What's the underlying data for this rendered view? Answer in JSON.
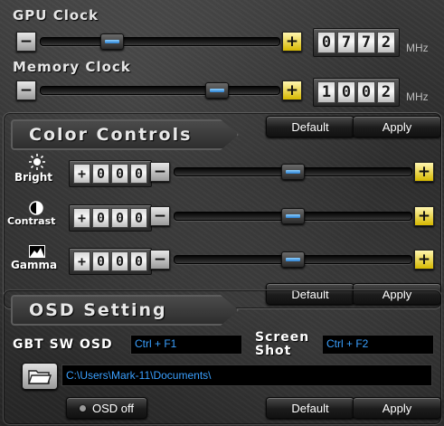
{
  "clock": {
    "gpu": {
      "title": "GPU Clock",
      "digits": [
        "0",
        "7",
        "7",
        "2"
      ],
      "unit": "MHz",
      "level": 0.26
    },
    "memory": {
      "title": "Memory Clock",
      "digits": [
        "1",
        "0",
        "0",
        "2"
      ],
      "unit": "MHz",
      "level": 0.66
    },
    "default_label": "Default",
    "apply_label": "Apply"
  },
  "color": {
    "banner": "Color Controls",
    "rows": [
      {
        "label": "Bright",
        "sign": "+",
        "digits": [
          "0",
          "0",
          "0"
        ],
        "level": 0.5,
        "icon": "sun-icon"
      },
      {
        "label": "Contrast",
        "sign": "+",
        "digits": [
          "0",
          "0",
          "0"
        ],
        "level": 0.5,
        "icon": "contrast-icon"
      },
      {
        "label": "Gamma",
        "sign": "+",
        "digits": [
          "0",
          "0",
          "0"
        ],
        "level": 0.5,
        "icon": "gamma-icon"
      }
    ],
    "default_label": "Default",
    "apply_label": "Apply"
  },
  "osd": {
    "banner": "OSD Setting",
    "gbt_label": "GBT SW OSD",
    "gbt_hotkey": "Ctrl + F1",
    "screenshot_label_1": "Screen",
    "screenshot_label_2": "Shot",
    "screenshot_hotkey": "Ctrl + F2",
    "path": "C:\\Users\\Mark-11\\Documents\\",
    "toggle_label": "OSD off",
    "default_label": "Default",
    "apply_label": "Apply"
  },
  "colors": {
    "accent": "#3aa0ff",
    "plus": "#d6b800"
  }
}
